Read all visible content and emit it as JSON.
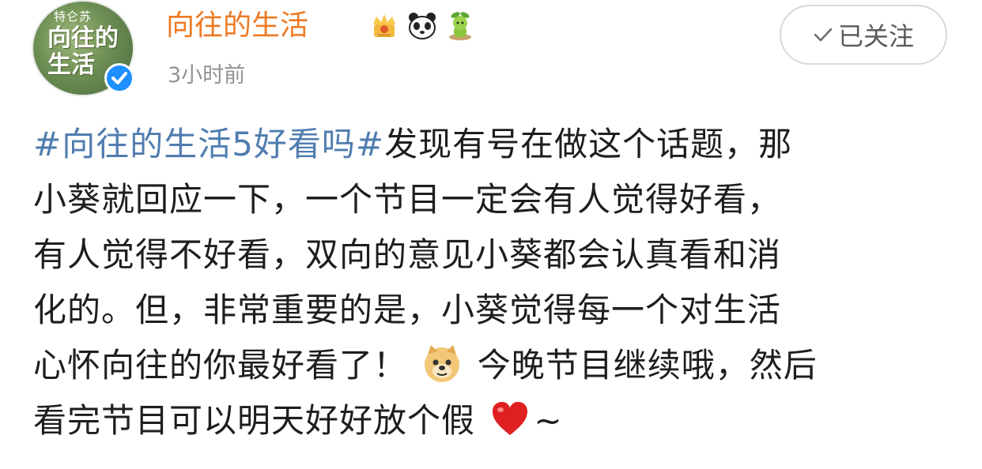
{
  "header": {
    "avatar_brand": "特仑苏",
    "avatar_logo": "向往的生活",
    "username": "向往的生活",
    "timestamp": "3小时前",
    "follow_label": "已关注",
    "badges": [
      "crown-badge-icon",
      "panda-badge-icon",
      "sprout-badge-icon"
    ]
  },
  "post": {
    "topic": "#向往的生活5好看吗#",
    "line1_rest": "发现有号在做这个话题，那",
    "line2": "小葵就回应一下，一个节目一定会有人觉得好看，",
    "line3": "有人觉得不好看，双向的意见小葵都会认真看和消",
    "line4": "化的。但，非常重要的是，小葵觉得每一个对生活",
    "line5_part1": "心怀向往的你最好看了！",
    "line5_part2": "今晚节目继续哦，然后",
    "line6": "看完节目可以明天好好放个假",
    "line6_end": "~"
  },
  "colors": {
    "username": "#ee7a23",
    "topic": "#507daf",
    "verified": "#1e90ff",
    "heart": "#e02020"
  }
}
